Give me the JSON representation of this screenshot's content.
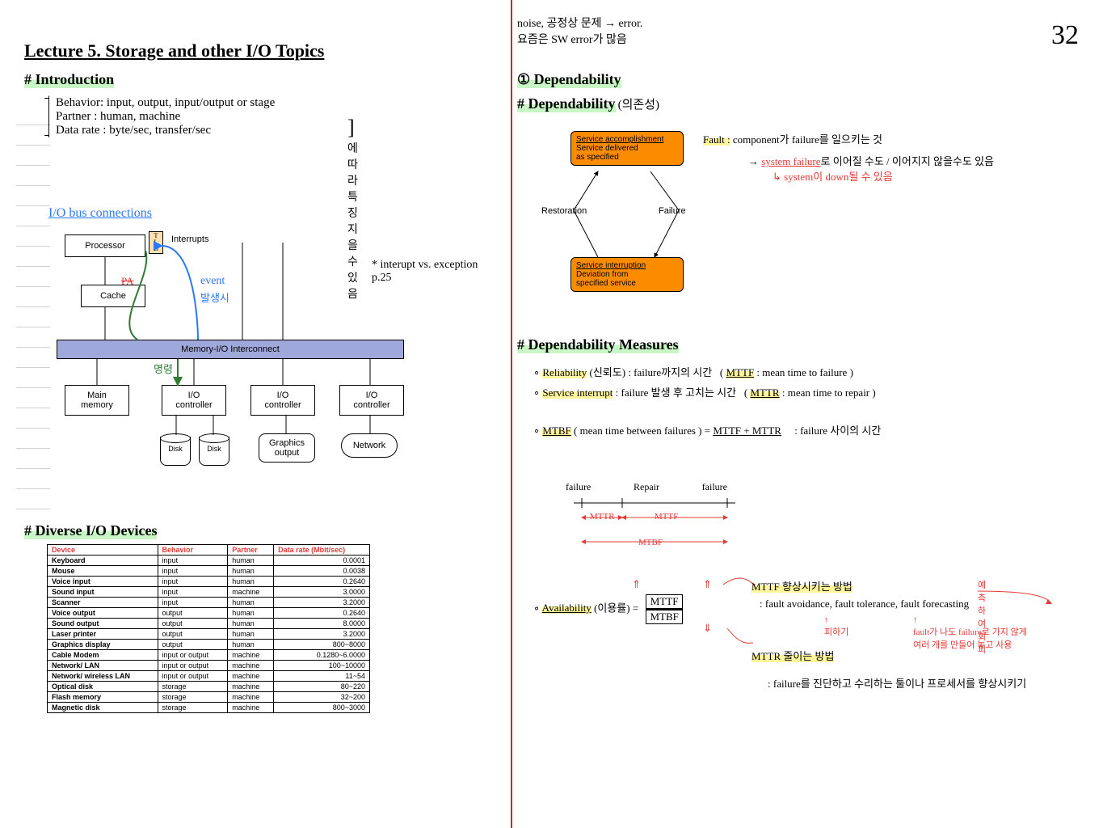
{
  "page_number": "32",
  "top_note_line1": "noise, 공정상 문제 → error.",
  "top_note_line2": "요즘은 SW error가 많음",
  "lecture_title": "Lecture 5. Storage and other I/O Topics",
  "intro": {
    "heading": "# Introduction",
    "behavior": "Behavior: input, output, input/output or stage",
    "partner": "Partner : human, machine",
    "datarate": "Data rate : byte/sec, transfer/sec",
    "bracket_note": "에 따라 특징지을 수 있음",
    "bus_heading": "I/O bus connections",
    "interrupts": "Interrupts",
    "event": "event",
    "event_sub": "발생시",
    "processor": "Processor",
    "cache": "Cache",
    "tlb": "T\nL\nB",
    "pa": "PA",
    "path_label": "명령",
    "interconnect": "Memory-I/O Interconnect",
    "mainmem": "Main\nmemory",
    "io_ctl": "I/O\ncontroller",
    "disk": "Disk",
    "graphics": "Graphics\noutput",
    "network": "Network",
    "cross_note": "* interupt vs. exception\n  p.25"
  },
  "devices": {
    "heading": "# Diverse I/O Devices",
    "headers": [
      "Device",
      "Behavior",
      "Partner",
      "Data rate (Mbit/sec)"
    ],
    "rows": [
      [
        "Keyboard",
        "input",
        "human",
        "0.0001"
      ],
      [
        "Mouse",
        "input",
        "human",
        "0.0038"
      ],
      [
        "Voice input",
        "input",
        "human",
        "0.2640"
      ],
      [
        "Sound input",
        "input",
        "machine",
        "3.0000"
      ],
      [
        "Scanner",
        "input",
        "human",
        "3.2000"
      ],
      [
        "Voice output",
        "output",
        "human",
        "0.2640"
      ],
      [
        "Sound output",
        "output",
        "human",
        "8.0000"
      ],
      [
        "Laser printer",
        "output",
        "human",
        "3.2000"
      ],
      [
        "Graphics display",
        "output",
        "human",
        "800~8000"
      ],
      [
        "Cable Modem",
        "input or output",
        "machine",
        "0.1280~6.0000"
      ],
      [
        "Network/ LAN",
        "input or output",
        "machine",
        "100~10000"
      ],
      [
        "Network/ wireless LAN",
        "input or output",
        "machine",
        "11~54"
      ],
      [
        "Optical disk",
        "storage",
        "machine",
        "80~220"
      ],
      [
        "Flash memory",
        "storage",
        "machine",
        "32~200"
      ],
      [
        "Magnetic disk",
        "storage",
        "machine",
        "800~3000"
      ]
    ]
  },
  "dep": {
    "section": "① Dependability",
    "heading": "# Dependability",
    "heading_note": "(의존성)",
    "sa_title": "Service accomplishment",
    "sa_sub": "Service delivered\nas specified",
    "si_title": "Service interruption",
    "si_sub": "Deviation from\nspecified service",
    "restoration": "Restoration",
    "failure": "Failure",
    "fault": "Fault :",
    "fault_txt": "component가 failure를 일으키는 것",
    "fault_arrow": "→ system failure로 이어질 수도 / 이어지지 않을수도 있음",
    "fault_sub": "system이 down될 수 있음",
    "measures_heading": "# Dependability Measures",
    "reliability": "Reliability",
    "reliability_sub": "(신뢰도) : failure까지의 시간",
    "mttf": "MTTF",
    "mttf_def": ": mean time to failure",
    "service_int": "Service interrupt",
    "service_int_sub": ": failure 발생 후 고치는 시간",
    "mttr": "MTTR",
    "mttr_def": "mean time to repair",
    "mtbf": "MTBF",
    "mtbf_def": "( mean time between failures ) =",
    "mtbf_formula": "MTTF + MTTR",
    "mtbf_note": ": failure 사이의 시간",
    "timeline_f1": "failure",
    "timeline_r": "Repair",
    "timeline_f2": "failure",
    "tl_mttr": "MTTR",
    "tl_mttf": "MTTF",
    "tl_mtbf": "MTBF",
    "avail": "Availability",
    "avail_sub": "(이용률) =",
    "avail_frac_top": "MTTF",
    "avail_frac_bot": "MTBF",
    "avail_up": "⇑",
    "avail_down": "⇓",
    "mttf_method": "MTTF 향상시키는 방법",
    "forecast_note": "예측하여 회피",
    "methods": ": fault avoidance, fault tolerance, fault forecasting",
    "avoid_note": "피하기",
    "tolerance_note": "fault가 나도 failure로 가지 않게\n여러 개를 만들어 놓고 사용",
    "mttr_method": "MTTR 줄이는 방법",
    "mttr_note": ": failure를 진단하고 수리하는 툴이나 프로세서를 향상시키기"
  }
}
